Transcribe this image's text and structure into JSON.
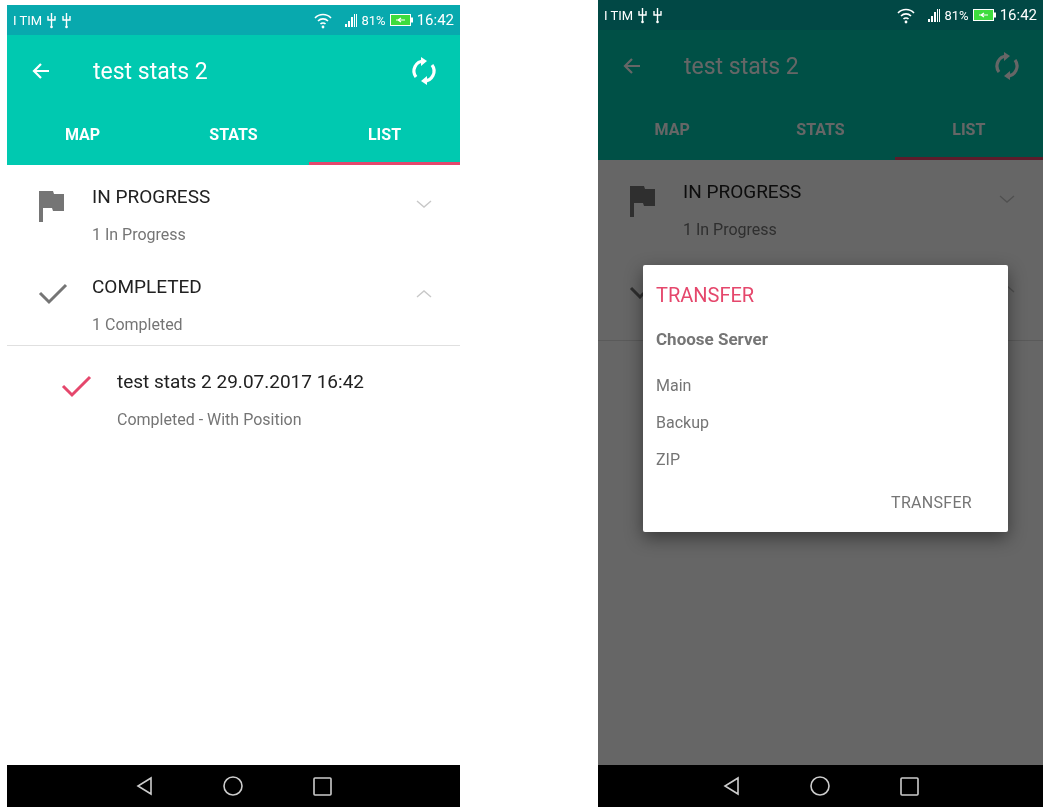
{
  "screens": [
    {
      "status_bar": {
        "carrier": "I TIM",
        "battery": "81%",
        "time": "16:42"
      },
      "app_bar": {
        "title": "test stats 2"
      },
      "tabs": [
        {
          "label": "MAP",
          "selected": false
        },
        {
          "label": "STATS",
          "selected": false
        },
        {
          "label": "LIST",
          "selected": true
        }
      ],
      "groups": [
        {
          "kind": "flag",
          "title": "IN PROGRESS",
          "subtitle": "1 In Progress",
          "expanded": false
        },
        {
          "kind": "check",
          "title": "COMPLETED",
          "subtitle": "1 Completed",
          "expanded": true,
          "items": [
            {
              "title": "test stats 2 29.07.2017 16:42",
              "subtitle": "Completed - With Position"
            }
          ]
        }
      ]
    },
    {
      "status_bar": {
        "carrier": "I TIM",
        "battery": "81%",
        "time": "16:42"
      },
      "app_bar": {
        "title": "test stats 2"
      },
      "tabs": [
        {
          "label": "MAP",
          "selected": false
        },
        {
          "label": "STATS",
          "selected": false
        },
        {
          "label": "LIST",
          "selected": true
        }
      ],
      "groups": [
        {
          "kind": "flag",
          "title": "IN PROGRESS",
          "subtitle": "1 In Progress",
          "expanded": false
        },
        {
          "kind": "check",
          "expanded": true
        }
      ],
      "dialog": {
        "title": "TRANSFER",
        "heading": "Choose Server",
        "options": [
          "Main",
          "Backup",
          "ZIP"
        ],
        "button": "TRANSFER"
      }
    }
  ]
}
